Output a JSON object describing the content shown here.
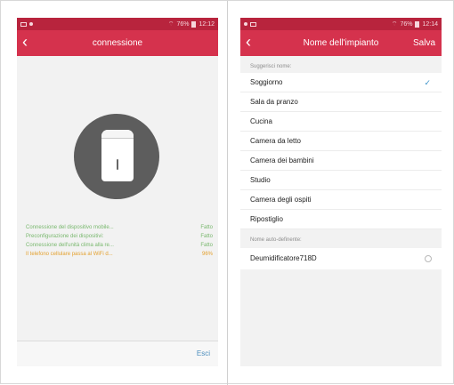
{
  "left_phone": {
    "status": {
      "time": "12:12",
      "battery": "76%"
    },
    "title": "connessione",
    "back_icon": "chevron-left-icon",
    "status_lines": [
      {
        "text": "Connessione del dispositivo mobile...",
        "state": "Fatto"
      },
      {
        "text": "Preconfigurazione dei dispositivi:",
        "state": "Fatto"
      },
      {
        "text": "Connessione dell'unità clima alla re...",
        "state": "Fatto"
      },
      {
        "text": "Il telefono cellulare passa al WiFi d...",
        "state": "96%"
      }
    ],
    "exit_label": "Esci"
  },
  "right_phone": {
    "status": {
      "time": "12:14",
      "battery": "76%"
    },
    "title": "Nome dell'impianto",
    "save_label": "Salva",
    "back_icon": "chevron-left-icon",
    "suggest_label": "Suggerisci nome:",
    "suggestions": [
      "Soggiorno",
      "Sala da pranzo",
      "Cucina",
      "Camera da letto",
      "Camera dei bambini",
      "Studio",
      "Camera degli ospiti",
      "Ripostiglio"
    ],
    "selected_index": 0,
    "custom_label": "Nome auto-definente:",
    "custom_value": "Deumidificatore718D"
  },
  "colors": {
    "status_bar": "#b8243d",
    "app_bar": "#d5324d",
    "success": "#79b86e",
    "progress": "#e4a12f",
    "link": "#4b8dbd"
  }
}
